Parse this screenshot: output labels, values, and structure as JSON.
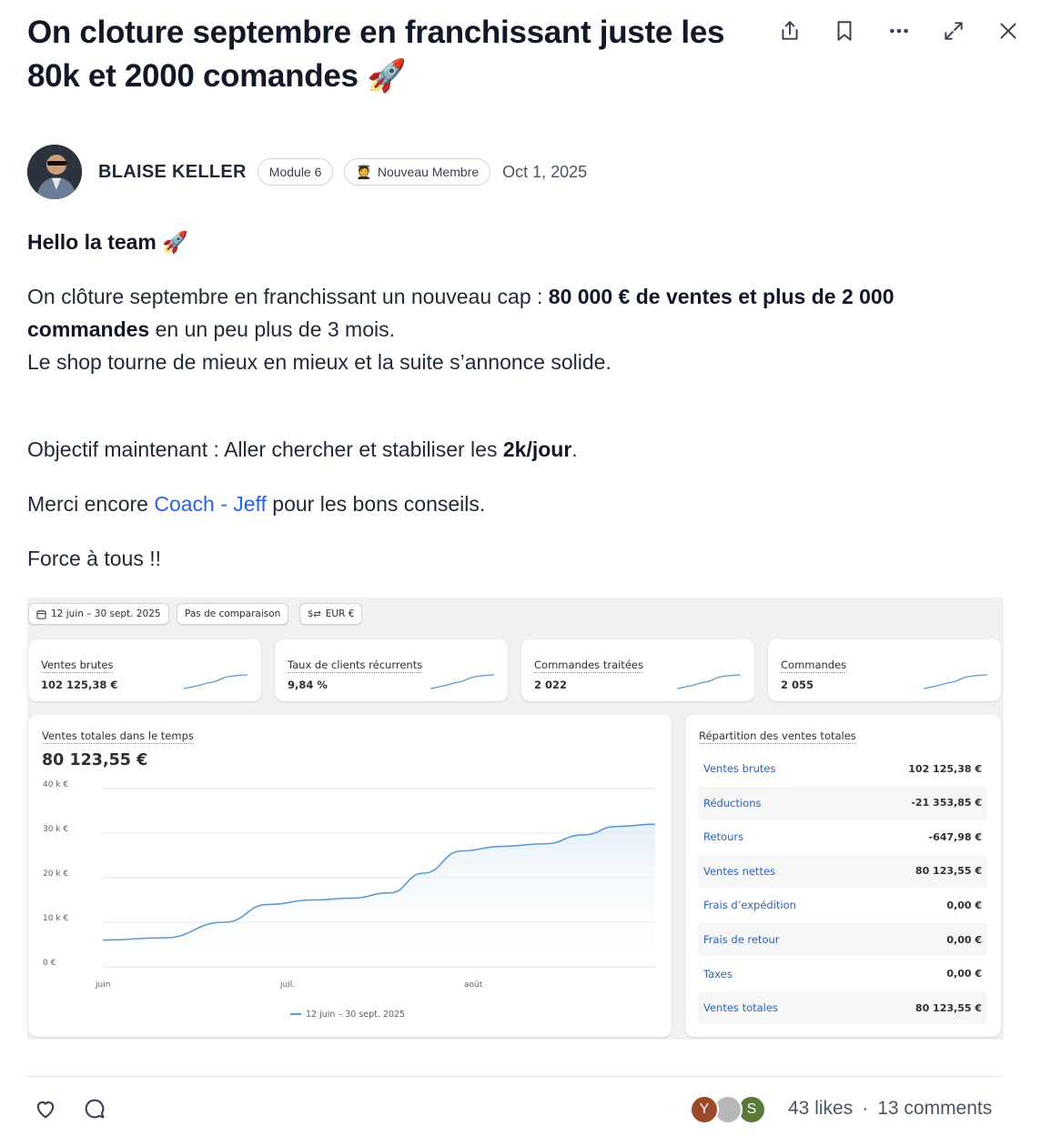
{
  "post": {
    "title": "On cloture septembre en franchissant juste les 80k et 2000 comandes 🚀",
    "author": "BLAISE KELLER",
    "badge_module": "Module 6",
    "badge_role_icon": "🧑‍🎓",
    "badge_role": "Nouveau Membre",
    "date": "Oct 1, 2025",
    "greeting": "Hello la team 🚀",
    "p1_a": "On clôture septembre en franchissant un nouveau cap : ",
    "p1_bold": "80 000 € de ventes et plus de 2 000 commandes",
    "p1_b": " en un peu plus de 3 mois.",
    "p1_line2": "Le shop tourne de mieux en mieux et la suite s’annonce solide.",
    "p2_a": "Objectif maintenant : Aller chercher et stabiliser les ",
    "p2_bold": "2k/jour",
    "p2_b": ".",
    "p3_a": "Merci encore ",
    "p3_link": "Coach - Jeff",
    "p3_b": " pour les bons conseils.",
    "p4": "Force à tous !!"
  },
  "toolbar": {
    "icons": [
      "share-icon",
      "bookmark-icon",
      "more-icon",
      "expand-icon",
      "close-icon"
    ]
  },
  "dashboard": {
    "date_range": "12 juin – 30 sept. 2025",
    "comparison": "Pas de comparaison",
    "currency": "EUR €",
    "kpis": [
      {
        "label": "Ventes brutes",
        "value": "102 125,38 €"
      },
      {
        "label": "Taux de clients récurrents",
        "value": "9,84 %"
      },
      {
        "label": "Commandes traitées",
        "value": "2 022"
      },
      {
        "label": "Commandes",
        "value": "2 055"
      }
    ],
    "sales_card_title": "Ventes totales dans le temps",
    "sales_total": "80 123,55 €",
    "legend": "12 juin – 30 sept. 2025",
    "breakdown_title": "Répartition des ventes totales",
    "breakdown": [
      {
        "label": "Ventes brutes",
        "value": "102 125,38 €"
      },
      {
        "label": "Réductions",
        "value": "-21 353,85 €"
      },
      {
        "label": "Retours",
        "value": "-647,98 €"
      },
      {
        "label": "Ventes nettes",
        "value": "80 123,55 €"
      },
      {
        "label": "Frais d’expédition",
        "value": "0,00 €"
      },
      {
        "label": "Frais de retour",
        "value": "0,00 €"
      },
      {
        "label": "Taxes",
        "value": "0,00 €"
      },
      {
        "label": "Ventes totales",
        "value": "80 123,55 €"
      }
    ]
  },
  "chart_data": {
    "type": "area",
    "title": "Ventes totales dans le temps",
    "yticks": [
      "40 k €",
      "30 k €",
      "20 k €",
      "10 k €",
      "0 €"
    ],
    "ylim": [
      0,
      40000
    ],
    "xticks": [
      "juin",
      "juil.",
      "août"
    ],
    "series": [
      {
        "name": "12 juin – 30 sept. 2025",
        "x": [
          0,
          0.11,
          0.22,
          0.3,
          0.38,
          0.45,
          0.52,
          0.58,
          0.65,
          0.72,
          0.8,
          0.87,
          0.93,
          1.0
        ],
        "values": [
          6000,
          6500,
          10000,
          14000,
          15000,
          15400,
          16600,
          21000,
          26000,
          27000,
          27600,
          29600,
          31500,
          32000
        ]
      }
    ],
    "grid": true,
    "line_color": "#5b9bd5"
  },
  "footer": {
    "avatars": [
      {
        "letter": "Y",
        "color": "#9a4a2b"
      },
      {
        "letter": "",
        "color": "#b8b8b8"
      },
      {
        "letter": "S",
        "color": "#5b7a3a"
      }
    ],
    "likes": "43 likes",
    "sep": "·",
    "comments": "13 comments"
  }
}
